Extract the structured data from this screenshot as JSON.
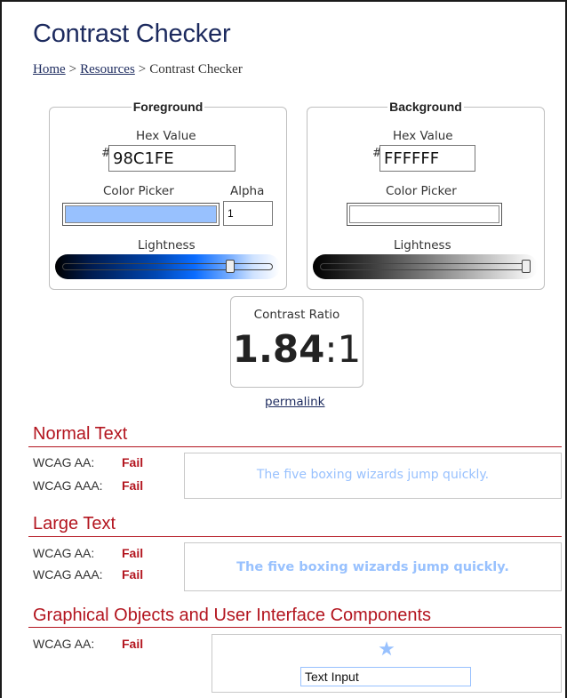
{
  "page": {
    "title": "Contrast Checker",
    "breadcrumb": {
      "home": "Home",
      "resources": "Resources",
      "current": "Contrast Checker",
      "separator": ">"
    }
  },
  "foreground": {
    "legend": "Foreground",
    "hex_label": "Hex Value",
    "hash": "#",
    "hex_value": "98C1FE",
    "picker_label": "Color Picker",
    "alpha_label": "Alpha",
    "alpha_value": "1",
    "lightness_label": "Lightness",
    "lightness_level": 0.81,
    "color": "#98C1FE"
  },
  "background": {
    "legend": "Background",
    "hex_label": "Hex Value",
    "hash": "#",
    "hex_value": "FFFFFF",
    "picker_label": "Color Picker",
    "lightness_label": "Lightness",
    "lightness_level": 1.0,
    "color": "#FFFFFF"
  },
  "contrast": {
    "label": "Contrast Ratio",
    "ratio_value": "1.84",
    "ratio_suffix": ":1",
    "permalink": "permalink"
  },
  "sections": {
    "normal": {
      "title": "Normal Text",
      "aa_label": "WCAG AA:",
      "aa_result": "Fail",
      "aaa_label": "WCAG AAA:",
      "aaa_result": "Fail",
      "sample": "The five boxing wizards jump quickly."
    },
    "large": {
      "title": "Large Text",
      "aa_label": "WCAG AA:",
      "aa_result": "Fail",
      "aaa_label": "WCAG AAA:",
      "aaa_result": "Fail",
      "sample": "The five boxing wizards jump quickly."
    },
    "graphical": {
      "title": "Graphical Objects and User Interface Components",
      "aa_label": "WCAG AA:",
      "aa_result": "Fail",
      "star_icon": "star-icon",
      "input_value": "Text Input"
    }
  },
  "colors": {
    "title": "#1c2a5e",
    "section_red": "#b3151f",
    "foreground": "#98C1FE",
    "background": "#FFFFFF"
  }
}
